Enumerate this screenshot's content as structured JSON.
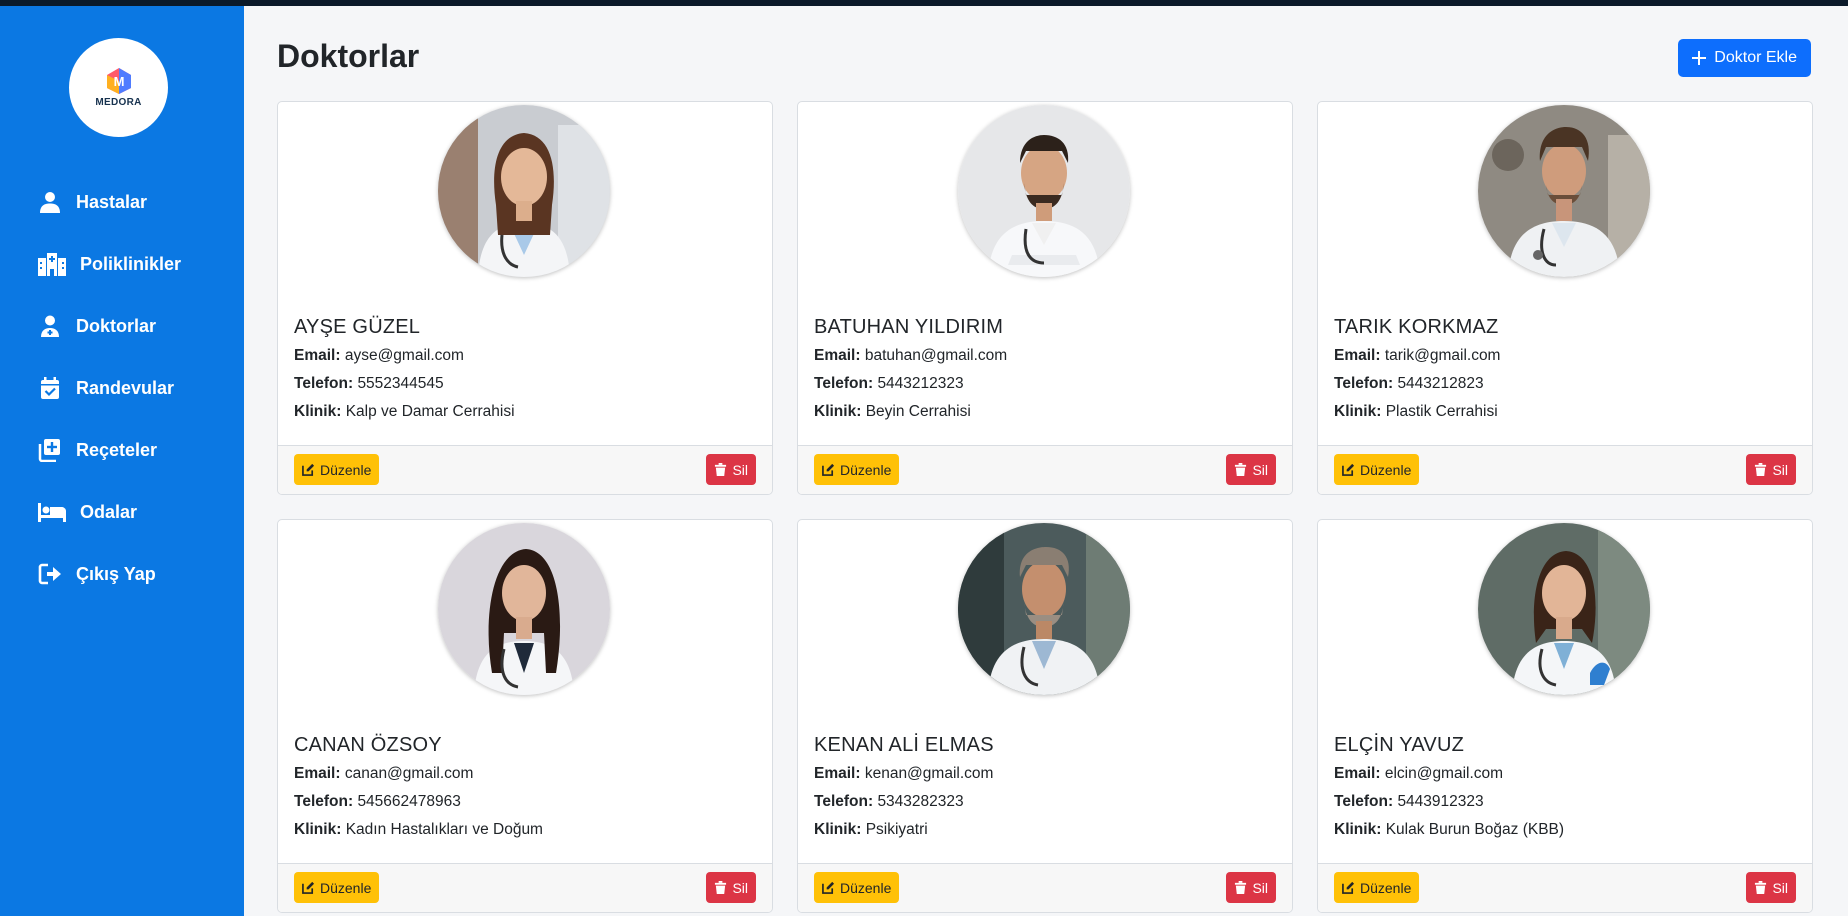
{
  "app": {
    "logo_text": "MEDORA",
    "logo_letter": "M"
  },
  "sidebar": {
    "items": [
      {
        "label": "Hastalar",
        "icon": "user-icon"
      },
      {
        "label": "Poliklinikler",
        "icon": "hospital-icon"
      },
      {
        "label": "Doktorlar",
        "icon": "doctor-icon"
      },
      {
        "label": "Randevular",
        "icon": "calendar-check-icon"
      },
      {
        "label": "Reçeteler",
        "icon": "prescription-icon"
      },
      {
        "label": "Odalar",
        "icon": "bed-icon"
      },
      {
        "label": "Çıkış Yap",
        "icon": "logout-icon"
      }
    ]
  },
  "page": {
    "title": "Doktorlar",
    "add_button": "Doktor Ekle"
  },
  "labels": {
    "email": "Email:",
    "phone": "Telefon:",
    "clinic": "Klinik:",
    "edit": "Düzenle",
    "delete": "Sil"
  },
  "doctors": [
    {
      "name": "AYŞE GÜZEL",
      "email": "ayse@gmail.com",
      "phone": "5552344545",
      "clinic": "Kalp ve Damar Cerrahisi"
    },
    {
      "name": "BATUHAN YILDIRIM",
      "email": "batuhan@gmail.com",
      "phone": "5443212323",
      "clinic": "Beyin Cerrahisi"
    },
    {
      "name": "TARIK KORKMAZ",
      "email": "tarik@gmail.com",
      "phone": "5443212823",
      "clinic": "Plastik Cerrahisi"
    },
    {
      "name": "CANAN ÖZSOY",
      "email": "canan@gmail.com",
      "phone": "545662478963",
      "clinic": "Kadın Hastalıkları ve Doğum"
    },
    {
      "name": "KENAN ALİ ELMAS",
      "email": "kenan@gmail.com",
      "phone": "5343282323",
      "clinic": "Psikiyatri"
    },
    {
      "name": "ELÇİN YAVUZ",
      "email": "elcin@gmail.com",
      "phone": "5443912323",
      "clinic": "Kulak Burun Boğaz (KBB)"
    }
  ],
  "colors": {
    "sidebar": "#0b78e3",
    "primary": "#0d6efd",
    "warning": "#ffc107",
    "danger": "#dc3545"
  }
}
